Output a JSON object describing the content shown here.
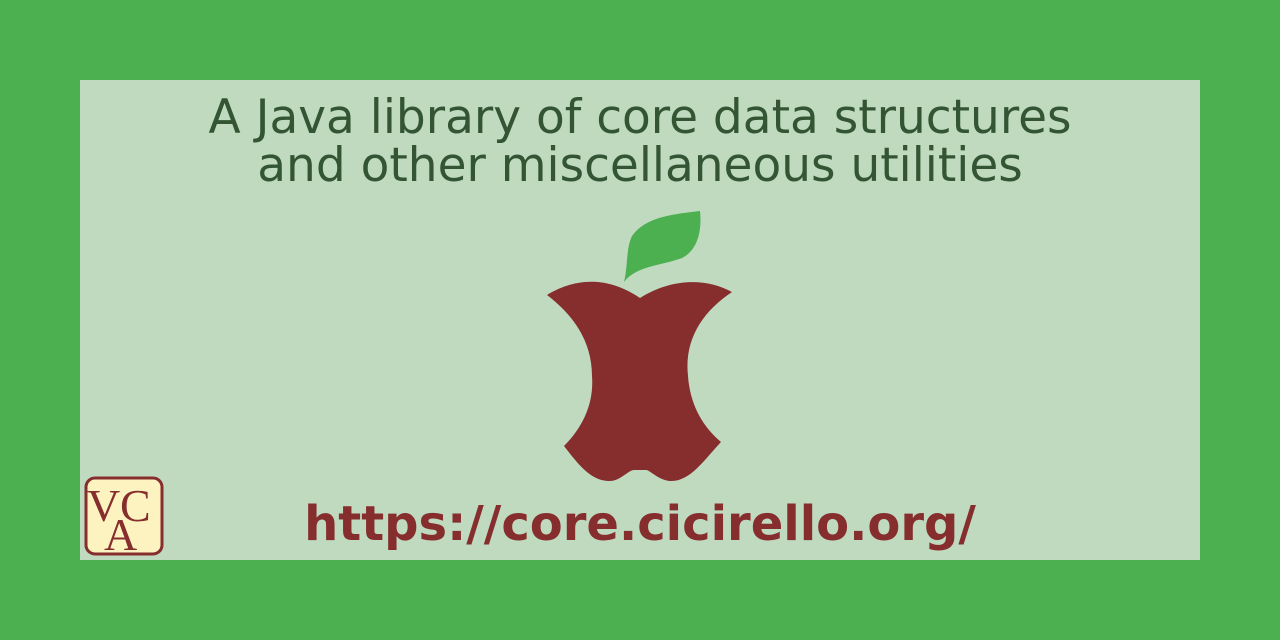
{
  "tagline": {
    "line1": "A Java library of core data structures",
    "line2": "and other miscellaneous utilities"
  },
  "url": "https://core.cicirello.org/",
  "logo": {
    "letters": "VCA",
    "icon": "vca-monogram-logo"
  },
  "apple": {
    "icon": "apple-core-icon",
    "leaf_icon": "leaf-icon"
  },
  "colors": {
    "background": "#4caf50",
    "panel": "#c0dac0",
    "tagline_text": "#335533",
    "apple": "#862d2d",
    "leaf": "#4caf50",
    "logo_fill": "#fcf3c0",
    "url_text": "#862d2d"
  }
}
